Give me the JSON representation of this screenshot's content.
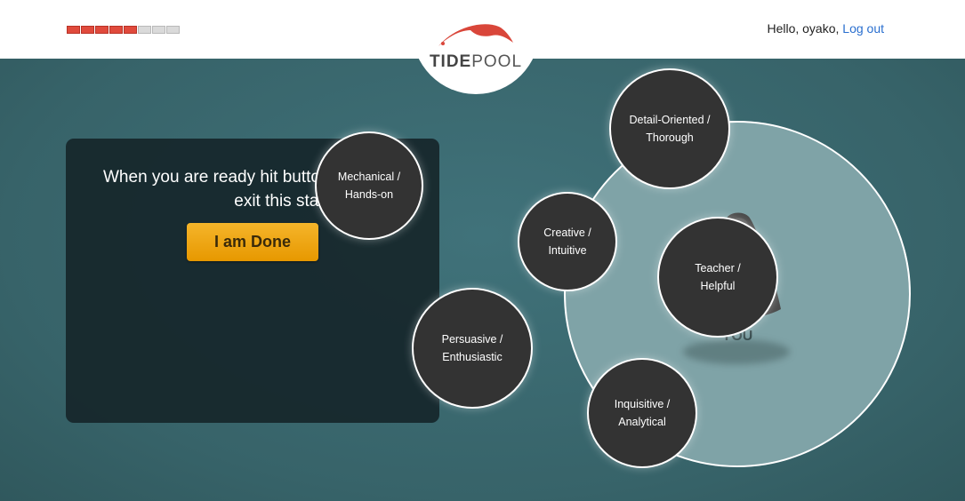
{
  "progress": {
    "completed": 5,
    "total": 8
  },
  "header": {
    "greeting": "Hello, oyako,",
    "logout_label": "Log out",
    "logo_bold": "TIDE",
    "logo_light": "POOL"
  },
  "colors": {
    "background": "#3d6a70",
    "panel": "#16262a",
    "accent_button": "#f0a500",
    "progress_done": "#e04a3c",
    "bubble": "#333333",
    "you_circle": "#7fa3a7",
    "link": "#2a6fcf"
  },
  "panel": {
    "instruction_line1": "When you are ready hit button to",
    "instruction_line2": "exit this stage.",
    "done_label": "I am Done"
  },
  "you_label": "YOU",
  "bubbles": [
    {
      "label": "Mechanical /\nHands-on"
    },
    {
      "label": "Detail-Oriented /\nThorough"
    },
    {
      "label": "Creative /\nIntuitive"
    },
    {
      "label": "Teacher /\nHelpful"
    },
    {
      "label": "Persuasive /\nEnthusiastic"
    },
    {
      "label": "Inquisitive /\nAnalytical"
    }
  ]
}
